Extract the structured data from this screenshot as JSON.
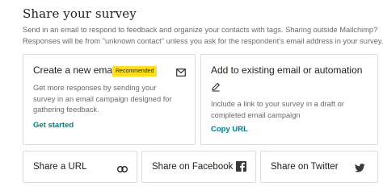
{
  "header": {
    "title": "Share your survey",
    "description_line1": "Send in an email to respond to feedback and organize your contacts with tags. Sharing outside Mailchimp?",
    "description_line2": "Responses will be from \"unknown contact\" unless you ask for the respondent's email address in your survey."
  },
  "cards": {
    "email": {
      "title": "Create a new email",
      "badge": "Recommended",
      "icon": "envelope-icon",
      "description": "Get more responses by sending your survey in an email campaign designed for gathering feedback.",
      "link": "Get started"
    },
    "existing": {
      "title": "Add to existing email or automation",
      "icon": "pencil-icon",
      "description": "Include a link to your survey in a draft or completed email campaign",
      "link": "Copy URL"
    }
  },
  "share": {
    "url": {
      "label": "Share a URL",
      "icon": "link-icon"
    },
    "facebook": {
      "label": "Share on Facebook",
      "icon": "facebook-icon"
    },
    "twitter": {
      "label": "Share on Twitter",
      "icon": "twitter-icon"
    }
  },
  "colors": {
    "link": "#007c89",
    "badge": "#ffe01b",
    "text": "#241c15",
    "muted": "#6b6b6b",
    "border": "#dcdcdc"
  }
}
